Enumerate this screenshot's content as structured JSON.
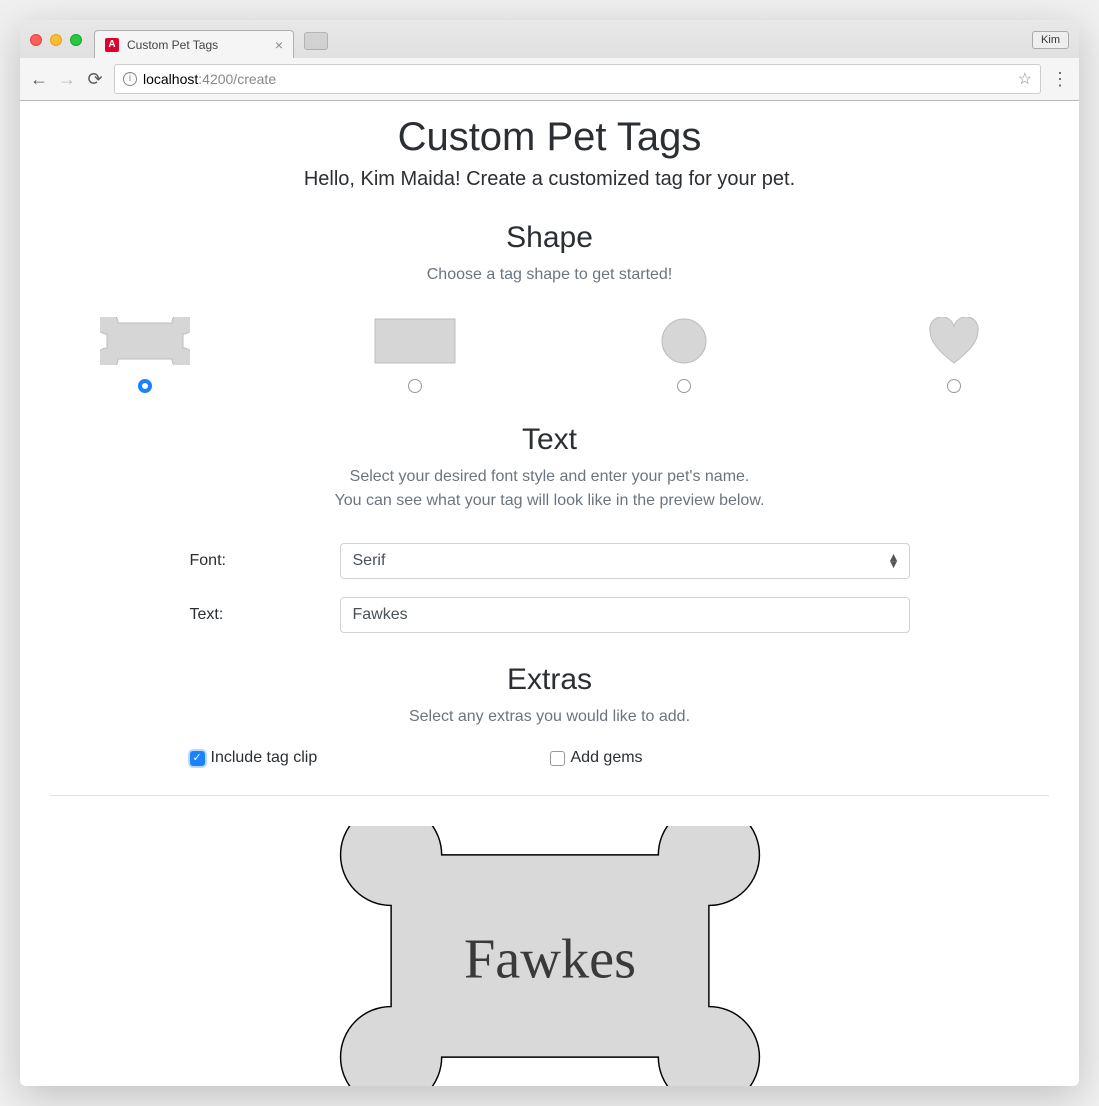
{
  "browser": {
    "tab_title": "Custom Pet Tags",
    "user_badge": "Kim",
    "url_host": "localhost",
    "url_port_path": ":4200/create"
  },
  "page": {
    "title": "Custom Pet Tags",
    "subtitle": "Hello, Kim Maida! Create a customized tag for your pet."
  },
  "shape": {
    "title": "Shape",
    "desc": "Choose a tag shape to get started!",
    "options": [
      {
        "name": "bone",
        "selected": true
      },
      {
        "name": "rectangle",
        "selected": false
      },
      {
        "name": "circle",
        "selected": false
      },
      {
        "name": "heart",
        "selected": false
      }
    ]
  },
  "text_section": {
    "title": "Text",
    "desc_line1": "Select your desired font style and enter your pet's name.",
    "desc_line2": "You can see what your tag will look like in the preview below.",
    "font_label": "Font:",
    "font_value": "Serif",
    "text_label": "Text:",
    "text_value": "Fawkes"
  },
  "extras": {
    "title": "Extras",
    "desc": "Select any extras you would like to add.",
    "items": [
      {
        "label": "Include tag clip",
        "checked": true
      },
      {
        "label": "Add gems",
        "checked": false
      }
    ]
  },
  "preview": {
    "text": "Fawkes"
  }
}
